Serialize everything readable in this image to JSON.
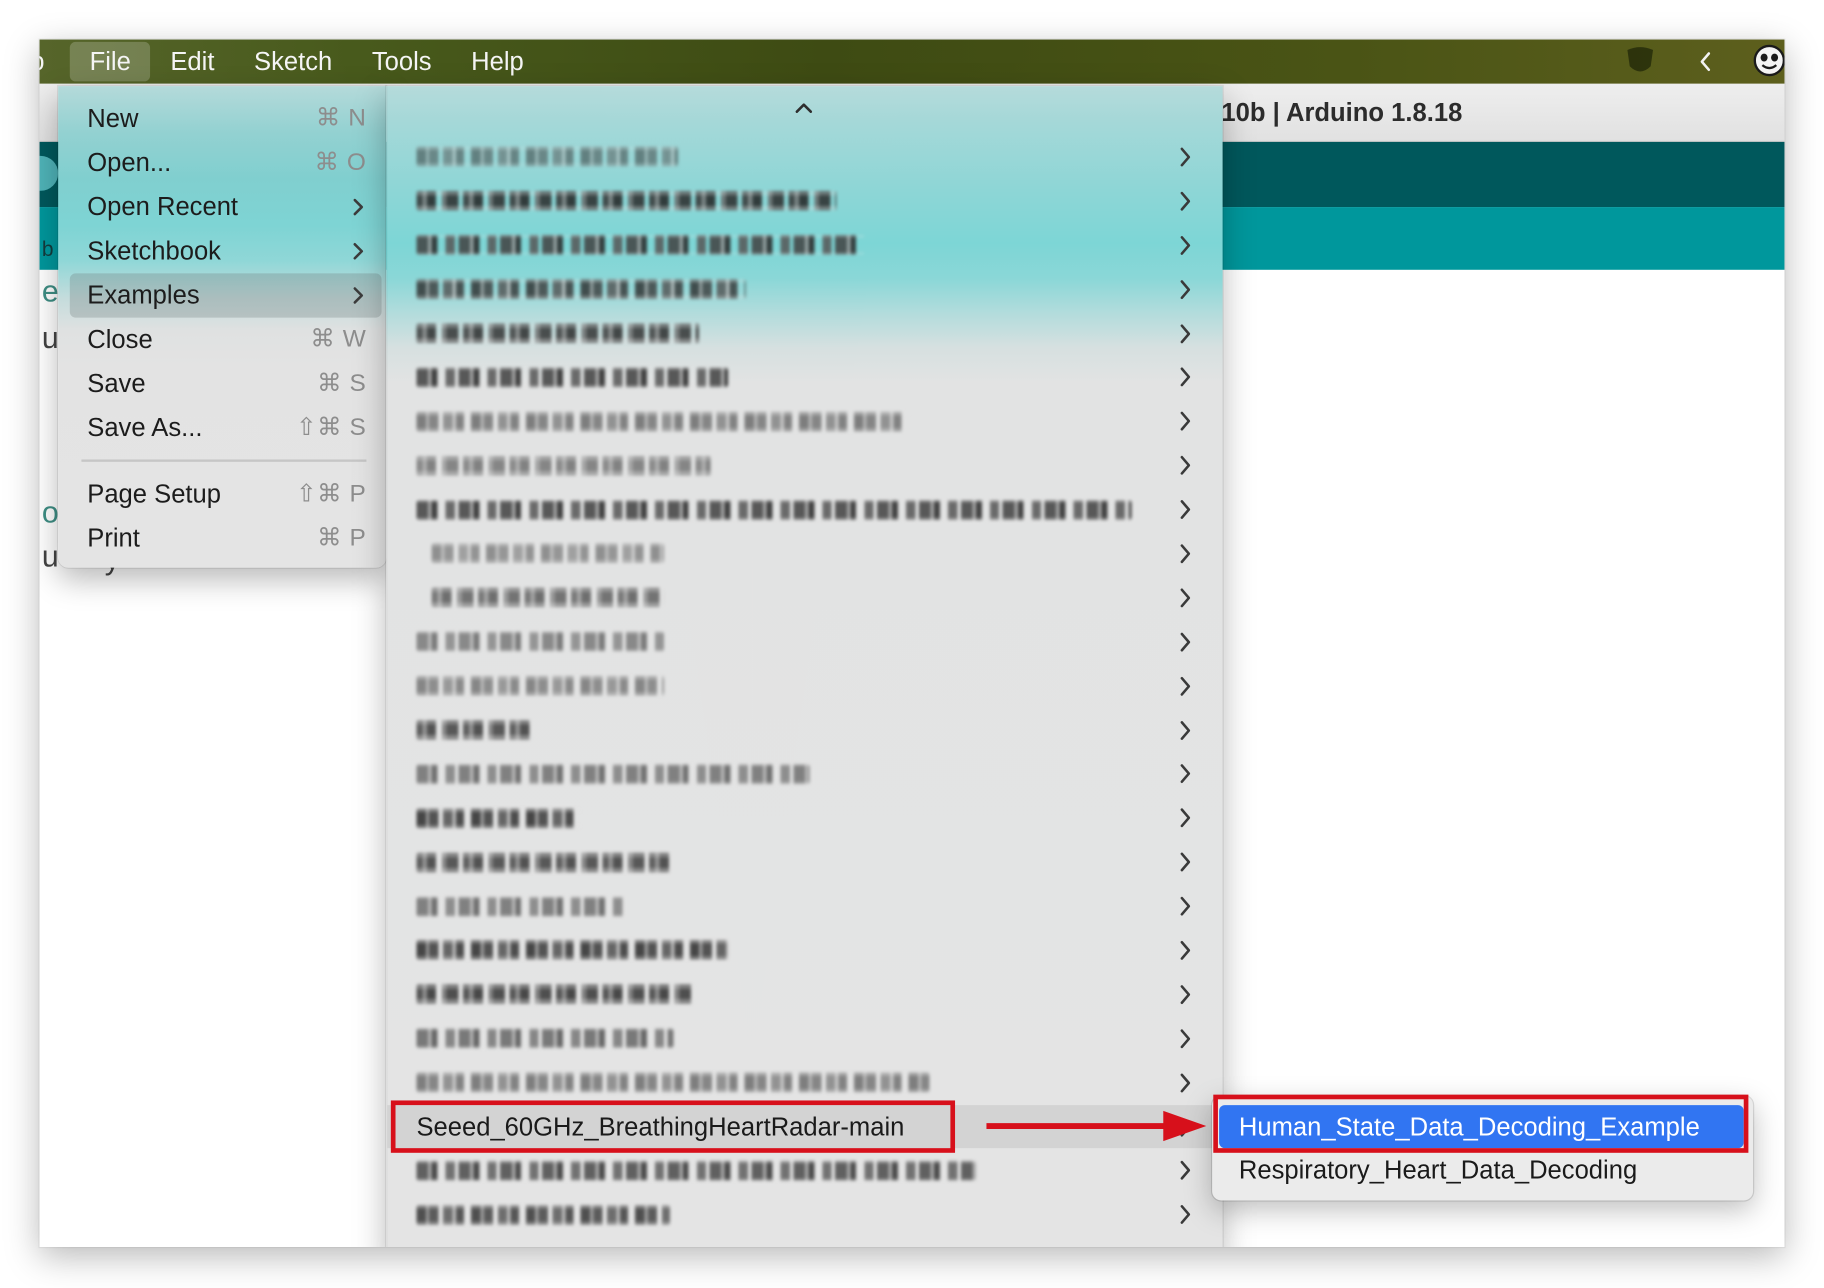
{
  "menubar": {
    "app_fragment": "o",
    "items": [
      {
        "label": "File",
        "active": true
      },
      {
        "label": "Edit"
      },
      {
        "label": "Sketch"
      },
      {
        "label": "Tools"
      },
      {
        "label": "Help"
      }
    ],
    "icons": [
      "shield-icon",
      "chevron-left-icon",
      "face-icon"
    ]
  },
  "window": {
    "title": "10b | Arduino 1.8.18"
  },
  "editor_fragments": {
    "tab": "b",
    "line1": "e",
    "line2": "u",
    "line3": "o",
    "line4": "u",
    "line5": "y"
  },
  "file_menu": {
    "items": [
      {
        "label": "New",
        "shortcut": "⌘ N"
      },
      {
        "label": "Open...",
        "shortcut": "⌘ O"
      },
      {
        "label": "Open Recent",
        "submenu": true
      },
      {
        "label": "Sketchbook",
        "submenu": true
      },
      {
        "label": "Examples",
        "submenu": true,
        "highlighted": true
      },
      {
        "label": "Close",
        "shortcut": "⌘ W"
      },
      {
        "label": "Save",
        "shortcut": "⌘ S"
      },
      {
        "label": "Save As...",
        "shortcut": "⇧⌘ S"
      },
      {
        "separator": true
      },
      {
        "label": "Page Setup",
        "shortcut": "⇧⌘ P"
      },
      {
        "label": "Print",
        "shortcut": "⌘ P"
      }
    ]
  },
  "examples_menu": {
    "scroll_icon": "chevron-up-icon",
    "items": [
      {
        "redacted": true
      },
      {
        "redacted": true
      },
      {
        "redacted": true
      },
      {
        "redacted": true
      },
      {
        "redacted": true
      },
      {
        "redacted": true
      },
      {
        "redacted": true
      },
      {
        "redacted": true
      },
      {
        "redacted": true
      },
      {
        "redacted": true
      },
      {
        "redacted": true
      },
      {
        "redacted": true
      },
      {
        "redacted": true
      },
      {
        "redacted": true
      },
      {
        "redacted": true
      },
      {
        "redacted": true
      },
      {
        "redacted": true
      },
      {
        "redacted": true
      },
      {
        "redacted": true
      },
      {
        "redacted": true
      },
      {
        "redacted": true
      },
      {
        "redacted": true
      },
      {
        "label": "Seeed_60GHz_BreathingHeartRadar-main",
        "selected": true
      },
      {
        "redacted": true
      },
      {
        "redacted": true
      }
    ]
  },
  "radar_submenu": {
    "items": [
      {
        "label": "Human_State_Data_Decoding_Example",
        "highlighted": true
      },
      {
        "label": "Respiratory_Heart_Data_Decoding"
      }
    ]
  },
  "colors": {
    "menubar": "#46561a",
    "toolbar": "#00585c",
    "tabbar": "#00979c",
    "selection_blue": "#3175f2",
    "annotation_red": "#d7101b"
  }
}
